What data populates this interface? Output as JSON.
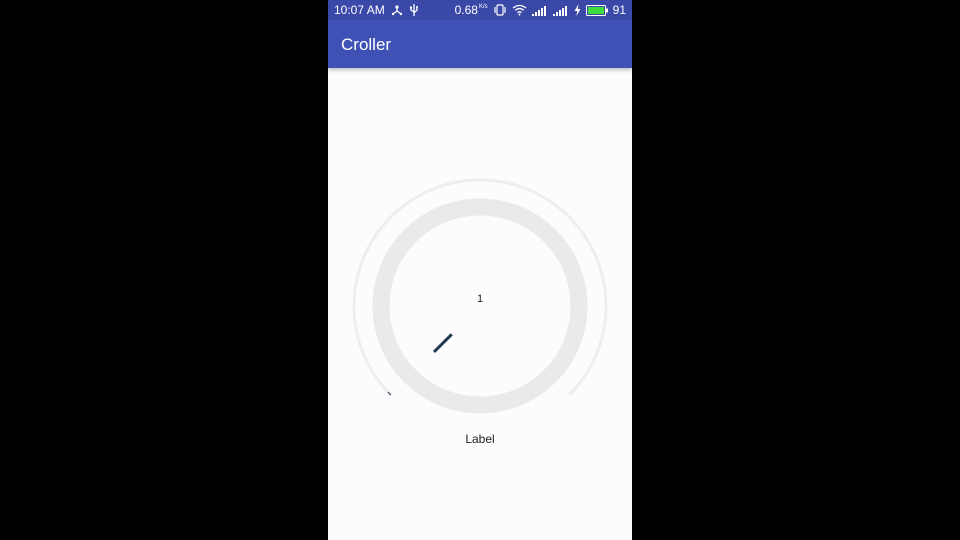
{
  "status_bar": {
    "time": "10:07 AM",
    "data_rate": "0.68",
    "data_rate_unit": "K/s",
    "battery_level": "91",
    "icons": [
      "usb-tether-icon",
      "usb-icon",
      "vibrate-icon",
      "wifi-icon",
      "signal-icon",
      "signal-icon-2",
      "charging-icon",
      "battery-icon"
    ]
  },
  "app_bar": {
    "title": "Croller"
  },
  "croller": {
    "value": "1",
    "label": "Label",
    "progress_fraction": 0.0,
    "colors": {
      "main_circle": "#ebe9eb",
      "back_arc": "#efedef",
      "indicator": "#1f3a4d",
      "app_bar": "#3f51b5",
      "status_bar": "#3a48a8"
    }
  }
}
